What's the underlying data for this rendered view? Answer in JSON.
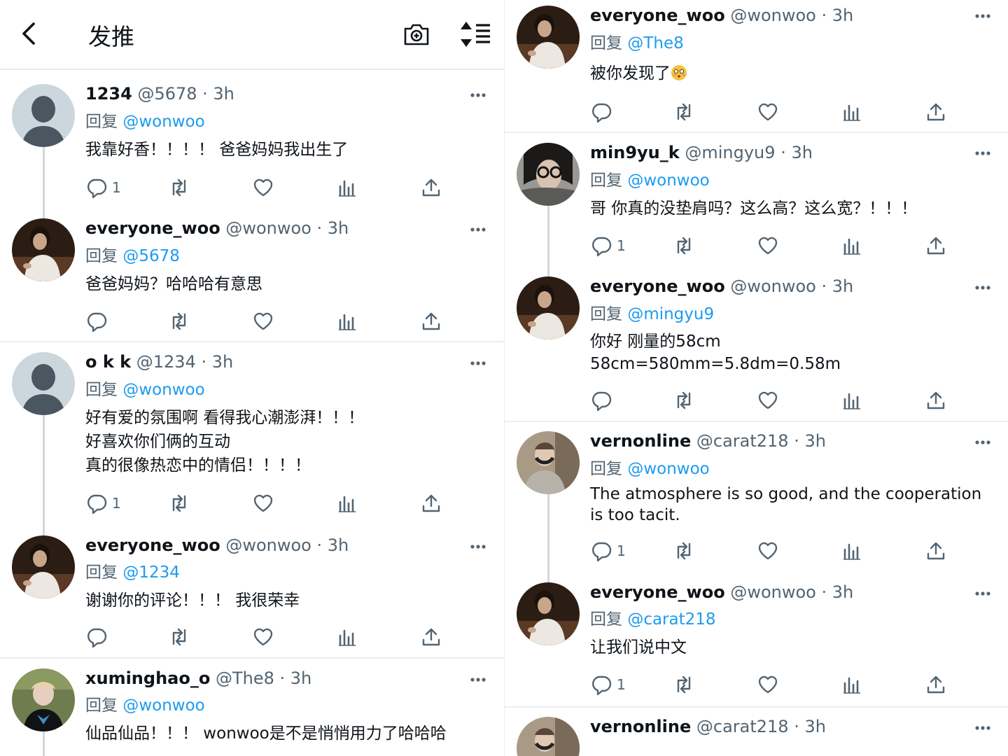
{
  "header": {
    "title": "发推"
  },
  "left": [
    {
      "name": "1234",
      "handle": "@5678",
      "time": "· 3h",
      "reply_prefix": "回复",
      "reply_to": "@wonwoo",
      "text": "我靠好香！！！！ 爸爸妈妈我出生了",
      "reply_count": "1"
    },
    {
      "name": "everyone_woo",
      "handle": "@wonwoo",
      "time": "· 3h",
      "reply_prefix": "回复",
      "reply_to": "@5678",
      "text": "爸爸妈妈？哈哈哈有意思",
      "reply_count": ""
    },
    {
      "name": "o k k",
      "handle": "@1234",
      "time": "· 3h",
      "reply_prefix": "回复",
      "reply_to": "@wonwoo",
      "text_lines": [
        "好有爱的氛围啊 看得我心潮澎湃！！！",
        "好喜欢你们俩的互动",
        "真的很像热恋中的情侣！！！！"
      ],
      "reply_count": "1"
    },
    {
      "name": "everyone_woo",
      "handle": "@wonwoo",
      "time": "· 3h",
      "reply_prefix": "回复",
      "reply_to": "@1234",
      "text": "谢谢你的评论！！！ 我很荣幸",
      "reply_count": ""
    },
    {
      "name": "xuminghao_o",
      "handle": "@The8",
      "time": "· 3h",
      "reply_prefix": "回复",
      "reply_to": "@wonwoo",
      "text": "仙品仙品！！！ wonwoo是不是悄悄用力了哈哈哈"
    }
  ],
  "right": [
    {
      "name": "everyone_woo",
      "handle": "@wonwoo",
      "time": "· 3h",
      "reply_prefix": "回复",
      "reply_to": "@The8",
      "text": "被你发现了",
      "emoji": "flushed-face-emoji",
      "reply_count": ""
    },
    {
      "name": "min9yu_k",
      "handle": "@mingyu9",
      "time": "· 3h",
      "reply_prefix": "回复",
      "reply_to": "@wonwoo",
      "text": "哥 你真的没垫肩吗？这么高？这么宽？！！！",
      "reply_count": "1"
    },
    {
      "name": "everyone_woo",
      "handle": "@wonwoo",
      "time": "· 3h",
      "reply_prefix": "回复",
      "reply_to": "@mingyu9",
      "text_lines": [
        "你好 刚量的58cm",
        "58cm=580mm=5.8dm=0.58m"
      ],
      "reply_count": ""
    },
    {
      "name": "vernonline",
      "handle": "@carat218",
      "time": "· 3h",
      "reply_prefix": "回复",
      "reply_to": "@wonwoo",
      "text_lines": [
        "The atmosphere is so good, and the cooperation",
        "is too tacit."
      ],
      "reply_count": "1"
    },
    {
      "name": "everyone_woo",
      "handle": "@wonwoo",
      "time": "· 3h",
      "reply_prefix": "回复",
      "reply_to": "@carat218",
      "text": "让我们说中文",
      "reply_count": "1"
    },
    {
      "name": "vernonline",
      "handle": "@carat218",
      "time": "· 3h"
    }
  ],
  "icons": {
    "back": "chevron-left-icon",
    "camera": "camera-icon",
    "sort": "sort-icon",
    "reply": "reply-icon",
    "retweet": "retweet-icon",
    "like": "heart-icon",
    "views": "views-icon",
    "share": "share-icon",
    "more": "more-icon"
  },
  "colors": {
    "link": "#1d9bf0",
    "secondary": "#536471",
    "text": "#0f1419",
    "divider": "#eceef0"
  }
}
